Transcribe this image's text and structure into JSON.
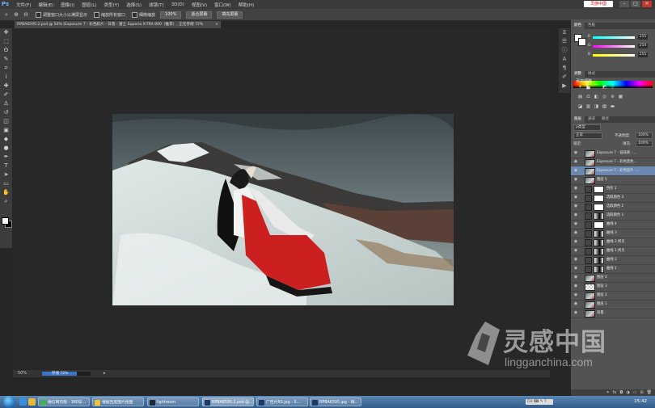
{
  "app": {
    "logo": "Ps",
    "menu": [
      "文件(F)",
      "编辑(E)",
      "图像(I)",
      "图层(L)",
      "类型(Y)",
      "选择(S)",
      "滤镜(T)",
      "3D(D)",
      "视图(V)",
      "窗口(W)",
      "帮助(H)"
    ],
    "brand_tag": "灵感中国",
    "window_controls": [
      "–",
      "□",
      "✕"
    ]
  },
  "options_bar": {
    "tool_icon": "zoom-icon",
    "resize_windows_label": "调整窗口大小以满屏显示",
    "zoom_all_label": "缩放所有窗口",
    "scrubby_zoom_label": "细微缩放",
    "btn_100": "100%",
    "btn_fit": "适合屏幕",
    "btn_fill": "填充屏幕"
  },
  "document": {
    "tab_title": "RPBA6595.2.psd @ 50% (Exposure 7 - 彩色胶片 - 日落 - 富士 Superia X-TRA 800（推荐）, 正在存储 72%",
    "tab_close": "×"
  },
  "status_bar": {
    "zoom": "50%",
    "progress_label": "存储 72%",
    "progress": 0.72,
    "arrow": "▸"
  },
  "color_panel": {
    "tabs": [
      "颜色",
      "色板"
    ],
    "r": 255,
    "g": 254,
    "b": 255,
    "r_label": "R",
    "g_label": "G",
    "b_label": "B"
  },
  "adjustments_panel": {
    "tabs": [
      "调整",
      "样式"
    ],
    "title": "添加调整"
  },
  "layers_panel": {
    "tabs": [
      "图层",
      "通道",
      "路径"
    ],
    "filter_label": "ρ类型",
    "blend_mode": "正常",
    "opacity_label": "不透明度:",
    "opacity": "100%",
    "lock_label": "锁定:",
    "fill_label": "填充:",
    "fill": "100%",
    "layers": [
      {
        "name": "Exposure 7 - 低保真 -...",
        "thumb": "photo",
        "selected": false
      },
      {
        "name": "Exposure 7 - 彩色黑色...",
        "thumb": "photo",
        "selected": false
      },
      {
        "name": "Exposure 7 - 彩色胶片 -...",
        "thumb": "photo",
        "selected": true
      },
      {
        "name": "图层 5",
        "thumb": "photo",
        "selected": false
      },
      {
        "name": "色阶 1",
        "thumb": "adj",
        "selected": false
      },
      {
        "name": "选取颜色 3",
        "thumb": "adj",
        "selected": false
      },
      {
        "name": "选取颜色 2",
        "thumb": "adj",
        "selected": false
      },
      {
        "name": "选取颜色 1",
        "thumb": "adjmask",
        "selected": false
      },
      {
        "name": "曲线 4",
        "thumb": "adj",
        "selected": false
      },
      {
        "name": "曲线 3",
        "thumb": "adjmask",
        "selected": false
      },
      {
        "name": "曲线 2 拷贝",
        "thumb": "adjmask",
        "selected": false
      },
      {
        "name": "曲线 1 拷贝",
        "thumb": "adjmask",
        "selected": false
      },
      {
        "name": "曲线 2",
        "thumb": "adjmask",
        "selected": false
      },
      {
        "name": "曲线 1",
        "thumb": "adjmask",
        "selected": false
      },
      {
        "name": "图层 4",
        "thumb": "photo",
        "selected": false
      },
      {
        "name": "图层 3",
        "thumb": "checker",
        "selected": false
      },
      {
        "name": "图层 2",
        "thumb": "photo",
        "selected": false
      },
      {
        "name": "图层 1",
        "thumb": "photo",
        "selected": false
      },
      {
        "name": "背景",
        "thumb": "photo",
        "selected": false
      }
    ],
    "footer_icons": [
      "link-icon",
      "fx-icon",
      "mask-icon",
      "adjustment-icon",
      "folder-icon",
      "new-layer-icon",
      "trash-icon"
    ]
  },
  "watermark": {
    "title": "灵感中国",
    "url": "lingganchina.com"
  },
  "taskbar": {
    "tasks": [
      {
        "label": "微信网页版 - 360安...",
        "color": "#3fb34f"
      },
      {
        "label": "根据百度图片搜图",
        "color": "#f1c232"
      },
      {
        "label": "lightroom",
        "color": "#1f2a38"
      },
      {
        "label": "RPBA6595.2.psd @...",
        "color": "#1b3a66"
      },
      {
        "label": "广告片RS.jpg - S...",
        "color": "#1b3a66"
      },
      {
        "label": "RPBA6595.jpg - 网...",
        "color": "#1b3a66"
      }
    ],
    "ime": "CH ⌨ ✎ ?",
    "clock": "15:42"
  },
  "colors": {
    "accent_selected_layer": "#6b88b0",
    "progress_fill": "#3b74c8",
    "taskbar": "#3a6a9c"
  }
}
